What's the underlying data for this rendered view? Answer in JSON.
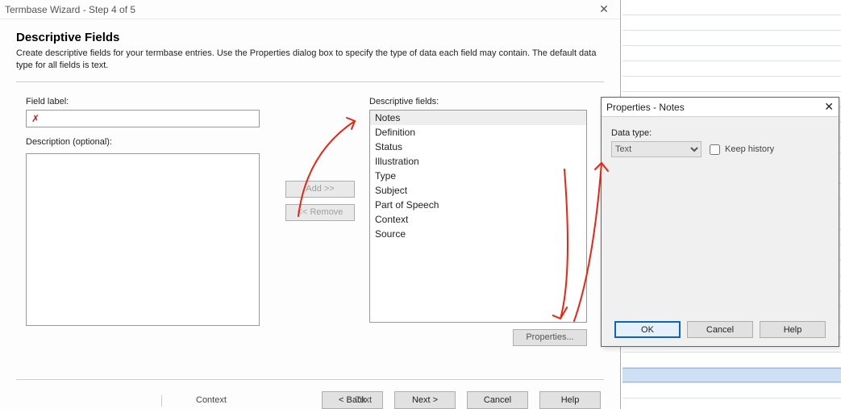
{
  "wizard": {
    "title": "Termbase Wizard - Step 4 of 5",
    "heading": "Descriptive Fields",
    "description": "Create descriptive fields for your termbase entries. Use the Properties dialog box to specify the type of data each field may contain. The default data type for all fields is text.",
    "field_label_lbl": "Field label:",
    "field_label_value": "✗",
    "description_lbl": "Description (optional):",
    "description_value": "",
    "add_btn": "Add >>",
    "remove_btn": "<< Remove",
    "list_lbl": "Descriptive fields:",
    "items": [
      {
        "label": "Notes"
      },
      {
        "label": "Definition"
      },
      {
        "label": "Status"
      },
      {
        "label": "Illustration"
      },
      {
        "label": "Type"
      },
      {
        "label": "Subject"
      },
      {
        "label": "Part of Speech"
      },
      {
        "label": "Context"
      },
      {
        "label": "Source"
      }
    ],
    "properties_btn": "Properties...",
    "back_btn": "< Back",
    "next_btn": "Next >",
    "cancel_btn": "Cancel",
    "help_btn": "Help",
    "bottom_left": "Context",
    "bottom_right": "Text"
  },
  "dialog": {
    "title": "Properties - Notes",
    "datatype_lbl": "Data type:",
    "datatype_value": "Text",
    "keep_history_lbl": "Keep history",
    "ok_btn": "OK",
    "cancel_btn": "Cancel",
    "help_btn": "Help"
  }
}
